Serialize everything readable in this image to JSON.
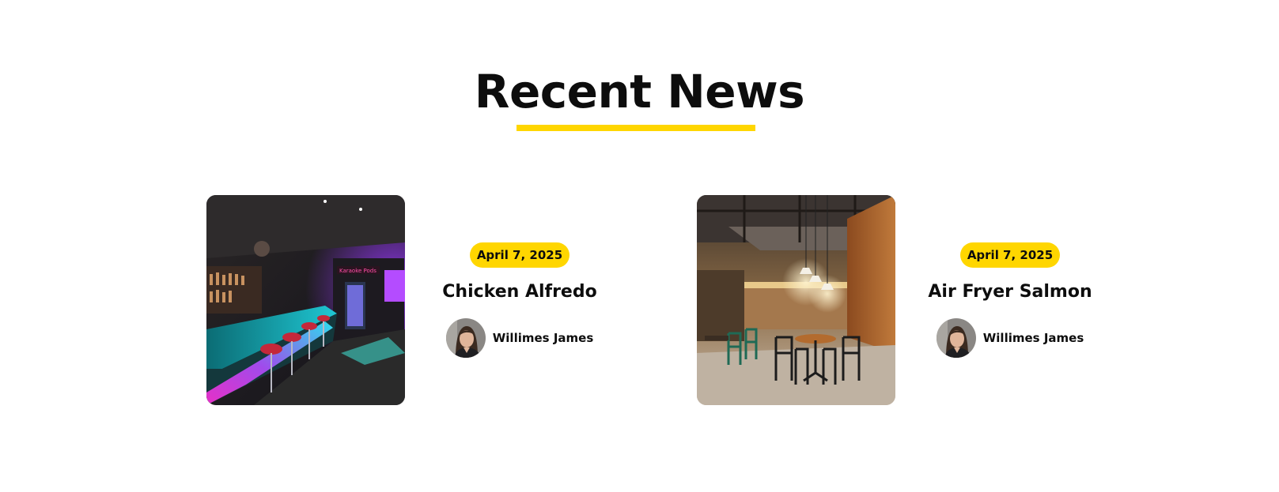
{
  "section": {
    "title": "Recent News",
    "accent_color": "#ffd600"
  },
  "news": [
    {
      "image": "karaoke-bar-neon-photo",
      "date": "April 7, 2025",
      "title": "Chicken Alfredo",
      "author": {
        "avatar": "woman-portrait-avatar",
        "name": "Willimes James"
      }
    },
    {
      "image": "restaurant-interior-photo",
      "date": "April 7, 2025",
      "title": "Air Fryer Salmon",
      "author": {
        "avatar": "woman-portrait-avatar",
        "name": "Willimes James"
      }
    }
  ]
}
